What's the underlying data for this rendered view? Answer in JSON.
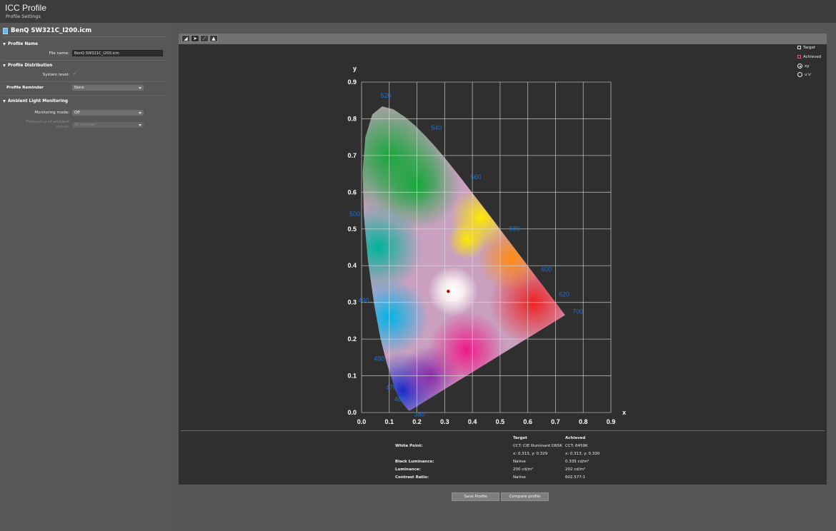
{
  "header": {
    "title": "ICC Profile",
    "subtitle": "Profile Settings"
  },
  "profile": {
    "file_title": "BenQ SW321C_I200.icm"
  },
  "profile_name": {
    "section": "Profile Name",
    "file_name_label": "File name:",
    "file_name_value": "BenQ SW321C_I200.icm"
  },
  "distribution": {
    "section": "Profile Distribution",
    "system_level_label": "System level:"
  },
  "reminder": {
    "label": "Profile Reminder",
    "value": "None"
  },
  "ambient": {
    "section": "Ambient Light Monitoring",
    "mode_label": "Monitoring mode:",
    "mode_value": "Off",
    "freq_label_1": "Frequency of ambient",
    "freq_label_2": "check:",
    "freq_value": "30 minutes"
  },
  "toolbar": {
    "icons": [
      "gamut-icon",
      "cursor-icon",
      "curve-icon",
      "image-icon"
    ]
  },
  "legend": {
    "target": "Target",
    "achieved": "Achieved",
    "xy": "xy",
    "uv": "u'v'"
  },
  "chart_data": {
    "type": "chromaticity-diagram",
    "xlabel": "x",
    "ylabel": "y",
    "xlim": [
      0.0,
      0.9
    ],
    "ylim": [
      0.0,
      0.9
    ],
    "xticks": [
      "0.0",
      "0.1",
      "0.2",
      "0.3",
      "0.4",
      "0.5",
      "0.6",
      "0.7",
      "0.8",
      "0.9"
    ],
    "yticks": [
      "0.0",
      "0.1",
      "0.2",
      "0.3",
      "0.4",
      "0.5",
      "0.6",
      "0.7",
      "0.8",
      "0.9"
    ],
    "grid": true,
    "wavelength_labels": [
      {
        "nm": "380",
        "x": 0.174,
        "y": 0.005
      },
      {
        "nm": "460",
        "x": 0.144,
        "y": 0.03
      },
      {
        "nm": "470",
        "x": 0.124,
        "y": 0.058
      },
      {
        "nm": "480",
        "x": 0.091,
        "y": 0.133
      },
      {
        "nm": "490",
        "x": 0.045,
        "y": 0.295
      },
      {
        "nm": "500",
        "x": 0.008,
        "y": 0.538
      },
      {
        "nm": "520",
        "x": 0.074,
        "y": 0.834
      },
      {
        "nm": "540",
        "x": 0.23,
        "y": 0.754
      },
      {
        "nm": "560",
        "x": 0.373,
        "y": 0.624
      },
      {
        "nm": "580",
        "x": 0.512,
        "y": 0.487
      },
      {
        "nm": "600",
        "x": 0.627,
        "y": 0.372
      },
      {
        "nm": "620",
        "x": 0.691,
        "y": 0.308
      },
      {
        "nm": "700",
        "x": 0.735,
        "y": 0.265
      }
    ],
    "white_point": {
      "x": 0.313,
      "y": 0.33
    }
  },
  "results": {
    "col_target": "Target",
    "col_achieved": "Achieved",
    "rows": [
      {
        "label": "White Point:",
        "target": "CCT: CIE Illuminant D65K",
        "achieved": "CCT: 6459K"
      },
      {
        "label": "",
        "target": "x: 0.313, y: 0.329",
        "achieved": "x: 0.313, y: 0.330"
      },
      {
        "label": "Black Luminance:",
        "target": "Native",
        "achieved": "0.335 cd/m²"
      },
      {
        "label": "Luminance:",
        "target": "200 cd/m²",
        "achieved": "202 cd/m²"
      },
      {
        "label": "Contrast Ratio:",
        "target": "Native",
        "achieved": "602.577:1"
      }
    ]
  },
  "buttons": {
    "save": "Save Profile",
    "compare": "Compare profile"
  }
}
